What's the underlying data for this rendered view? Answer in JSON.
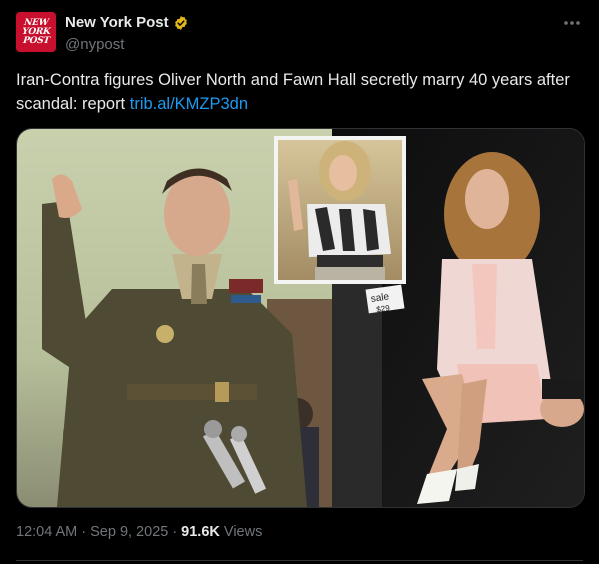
{
  "account": {
    "display_name": "New York Post",
    "handle": "@nypost",
    "avatar_text": [
      "NEW",
      "YORK",
      "POST"
    ],
    "avatar_color": "#c8102e",
    "verified_badge_color": "#e2b719",
    "verified_icon": "verified-badge-icon"
  },
  "more_icon": "more-options-icon",
  "post": {
    "text": "Iran-Contra figures Oliver North and Fawn Hall secretly marry 40 years after scandal: report ",
    "link_text": "trib.al/KMZP3dn",
    "link_color": "#1d9bf0"
  },
  "media": {
    "image_sign_text": [
      "sale",
      "$29"
    ]
  },
  "meta": {
    "time": "12:04 AM",
    "separator": "·",
    "date": "Sep 9, 2025",
    "views_count": "91.6K",
    "views_label": "Views"
  },
  "colors": {
    "background": "#000000",
    "primary_text": "#e7e9ea",
    "secondary_text": "#71767b",
    "border": "#2f3336"
  }
}
